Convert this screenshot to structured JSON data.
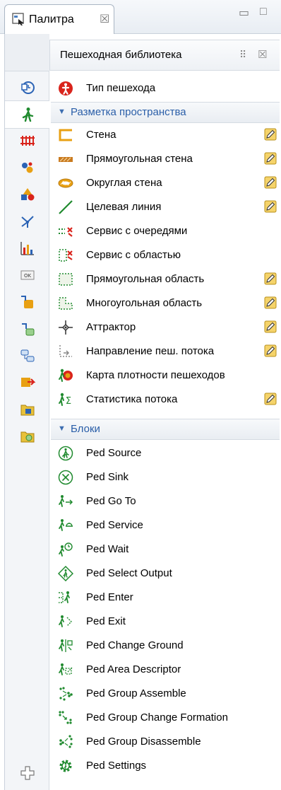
{
  "window": {
    "tab_label": "Палитра",
    "tab_close": "☒",
    "minimize": "▭",
    "maximize": "□"
  },
  "library": {
    "title": "Пешеходная библиотека",
    "grid_glyph": "⠿",
    "close": "☒"
  },
  "top_item": {
    "label": "Тип пешехода",
    "icon": "pedestrian-type-icon"
  },
  "sections": {
    "space": {
      "label": "Разметка пространства",
      "arrow": "▼"
    },
    "blocks": {
      "label": "Блоки",
      "arrow": "▼"
    }
  },
  "space_items": [
    {
      "label": "Стена",
      "icon": "wall-icon",
      "pencil": true
    },
    {
      "label": "Прямоугольная стена",
      "icon": "rect-wall-icon",
      "pencil": true
    },
    {
      "label": "Округлая стена",
      "icon": "round-wall-icon",
      "pencil": true
    },
    {
      "label": "Целевая линия",
      "icon": "target-line-icon",
      "pencil": true
    },
    {
      "label": "Сервис с очередями",
      "icon": "queue-service-icon",
      "pencil": false
    },
    {
      "label": "Сервис с областью",
      "icon": "area-service-icon",
      "pencil": false
    },
    {
      "label": "Прямоугольная область",
      "icon": "rect-area-icon",
      "pencil": true
    },
    {
      "label": "Многоугольная область",
      "icon": "poly-area-icon",
      "pencil": true
    },
    {
      "label": "Аттрактор",
      "icon": "attractor-icon",
      "pencil": true
    },
    {
      "label": "Направление пеш. потока",
      "icon": "flow-direction-icon",
      "pencil": true
    },
    {
      "label": "Карта плотности пешеходов",
      "icon": "density-map-icon",
      "pencil": false
    },
    {
      "label": "Статистика потока",
      "icon": "flow-stats-icon",
      "pencil": true
    }
  ],
  "block_items": [
    {
      "label": "Ped Source",
      "icon": "ped-source-icon"
    },
    {
      "label": "Ped Sink",
      "icon": "ped-sink-icon"
    },
    {
      "label": "Ped Go To",
      "icon": "ped-goto-icon"
    },
    {
      "label": "Ped Service",
      "icon": "ped-service-icon"
    },
    {
      "label": "Ped Wait",
      "icon": "ped-wait-icon"
    },
    {
      "label": "Ped Select Output",
      "icon": "ped-select-output-icon"
    },
    {
      "label": "Ped Enter",
      "icon": "ped-enter-icon"
    },
    {
      "label": "Ped Exit",
      "icon": "ped-exit-icon"
    },
    {
      "label": "Ped Change Ground",
      "icon": "ped-change-ground-icon"
    },
    {
      "label": "Ped Area Descriptor",
      "icon": "ped-area-descriptor-icon"
    },
    {
      "label": "Ped Group Assemble",
      "icon": "ped-group-assemble-icon"
    },
    {
      "label": "Ped Group Change Formation",
      "icon": "ped-group-change-formation-icon"
    },
    {
      "label": "Ped Group Disassemble",
      "icon": "ped-group-disassemble-icon"
    },
    {
      "label": "Ped Settings",
      "icon": "ped-settings-icon"
    }
  ],
  "strip_items": [
    {
      "icon": "process-library-icon"
    },
    {
      "icon": "pedestrian-library-icon",
      "active": true
    },
    {
      "icon": "rail-library-icon"
    },
    {
      "icon": "agent-icon"
    },
    {
      "icon": "presentation-icon"
    },
    {
      "icon": "network-icon"
    },
    {
      "icon": "analysis-icon"
    },
    {
      "icon": "controls-icon"
    },
    {
      "icon": "connectivity-icon"
    },
    {
      "icon": "system-dynamics-icon"
    },
    {
      "icon": "statechart-icon"
    },
    {
      "icon": "actions-icon"
    },
    {
      "icon": "pictures-icon"
    },
    {
      "icon": "3d-objects-icon"
    }
  ],
  "colors": {
    "section_text": "#2a5ea8",
    "ped_green": "#1f8a2e",
    "red": "#d9241c",
    "orange": "#e8a013"
  }
}
